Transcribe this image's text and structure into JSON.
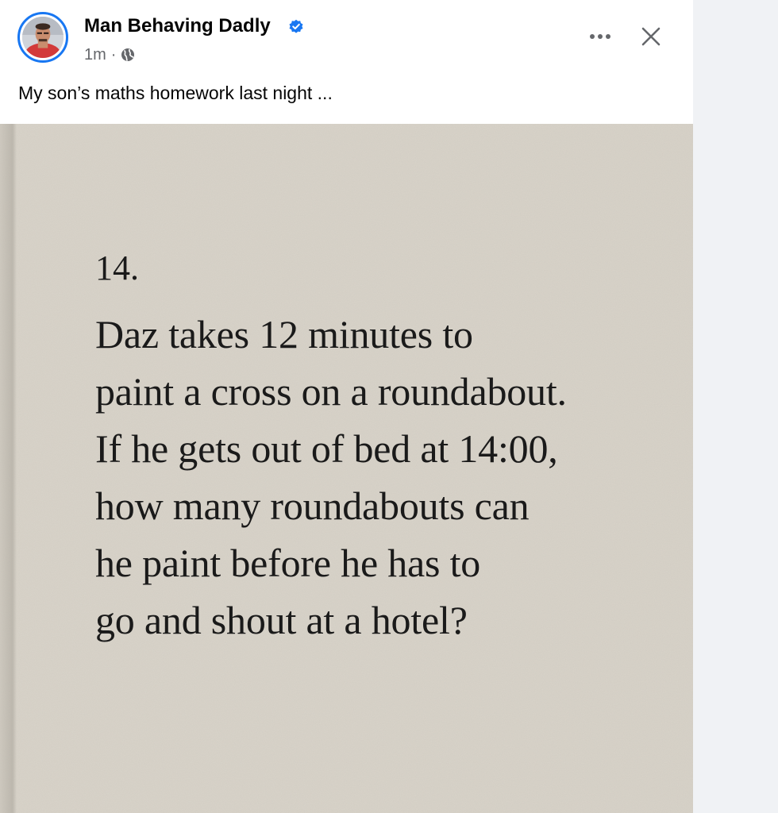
{
  "post": {
    "author": "Man Behaving Dadly",
    "time": "1m",
    "separator": "·",
    "caption": "My son’s maths homework last night ...",
    "icons": {
      "verified": "verified-badge-icon",
      "audience": "globe-icon",
      "more": "more-options-icon",
      "close": "close-icon"
    },
    "colors": {
      "accent": "#1877f2",
      "text": "#050505",
      "secondary": "#65676b"
    }
  },
  "photo": {
    "question_number": "14.",
    "question_lines": [
      "Daz takes 12 minutes to",
      "paint a cross on a roundabout.",
      "If he gets out of bed at 14:00,",
      "how many roundabouts can",
      "he paint before he has to",
      "go and shout at a hotel?"
    ]
  }
}
